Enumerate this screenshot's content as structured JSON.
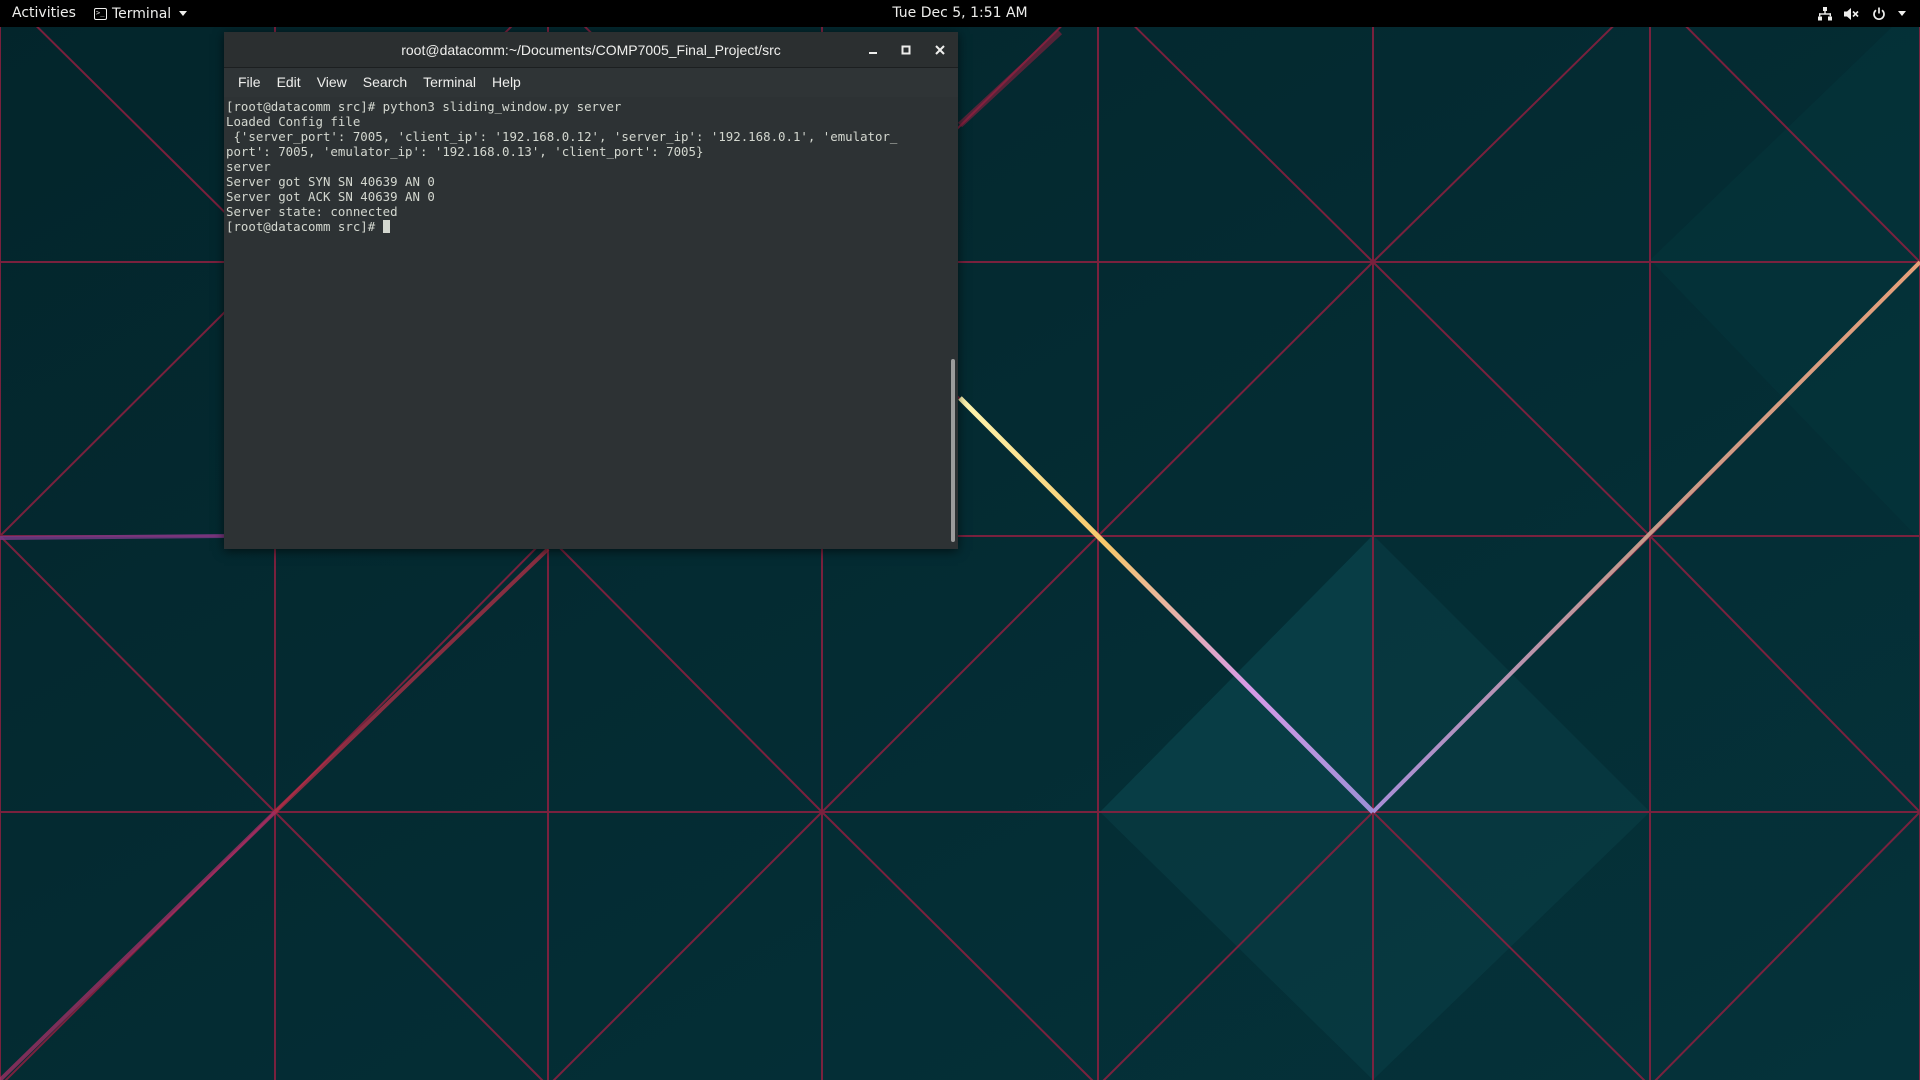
{
  "topbar": {
    "activities_label": "Activities",
    "app_menu_label": "Terminal",
    "clock": "Tue Dec  5,  1:51 AM",
    "tray_icons": [
      "network-icon",
      "volume-muted-icon",
      "power-icon",
      "chevron-down-icon"
    ]
  },
  "window": {
    "title": "root@datacomm:~/Documents/COMP7005_Final_Project/src",
    "menu": [
      "File",
      "Edit",
      "View",
      "Search",
      "Terminal",
      "Help"
    ],
    "lines": [
      "[root@datacomm src]# python3 sliding_window.py server",
      "Loaded Config file",
      " {'server_port': 7005, 'client_ip': '192.168.0.12', 'server_ip': '192.168.0.1', 'emulator_",
      "port': 7005, 'emulator_ip': '192.168.0.13', 'client_port': 7005}",
      "server",
      "Server got SYN SN 40639 AN 0",
      "Server got ACK SN 40639 AN 0",
      "Server state: connected"
    ],
    "prompt": "[root@datacomm src]# ",
    "scrollbar_position": 0.58
  },
  "colors": {
    "topbar_bg": "#000000",
    "wallpaper_bg": "#032a30",
    "grid_line": "#a0234a",
    "terminal_bg": "#2d3234",
    "terminal_fg": "#d3d7cf"
  }
}
